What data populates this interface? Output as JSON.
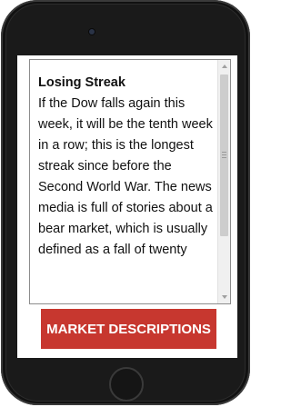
{
  "article": {
    "title": "Losing Streak",
    "body": "If the Dow falls again this week, it will be the tenth week in a row; this is the longest streak since before the Second World War. The news media is full of stories about a bear market, which is usually defined as a fall of twenty"
  },
  "actions": {
    "market_descriptions_label": "MARKET DESCRIPTIONS"
  },
  "colors": {
    "accent": "#c7372f",
    "phone_frame": "#111111"
  },
  "icons": {
    "scroll_up": "scroll-up-arrow-icon",
    "scroll_down": "scroll-down-arrow-icon",
    "camera": "camera-icon",
    "home": "home-button-icon"
  }
}
